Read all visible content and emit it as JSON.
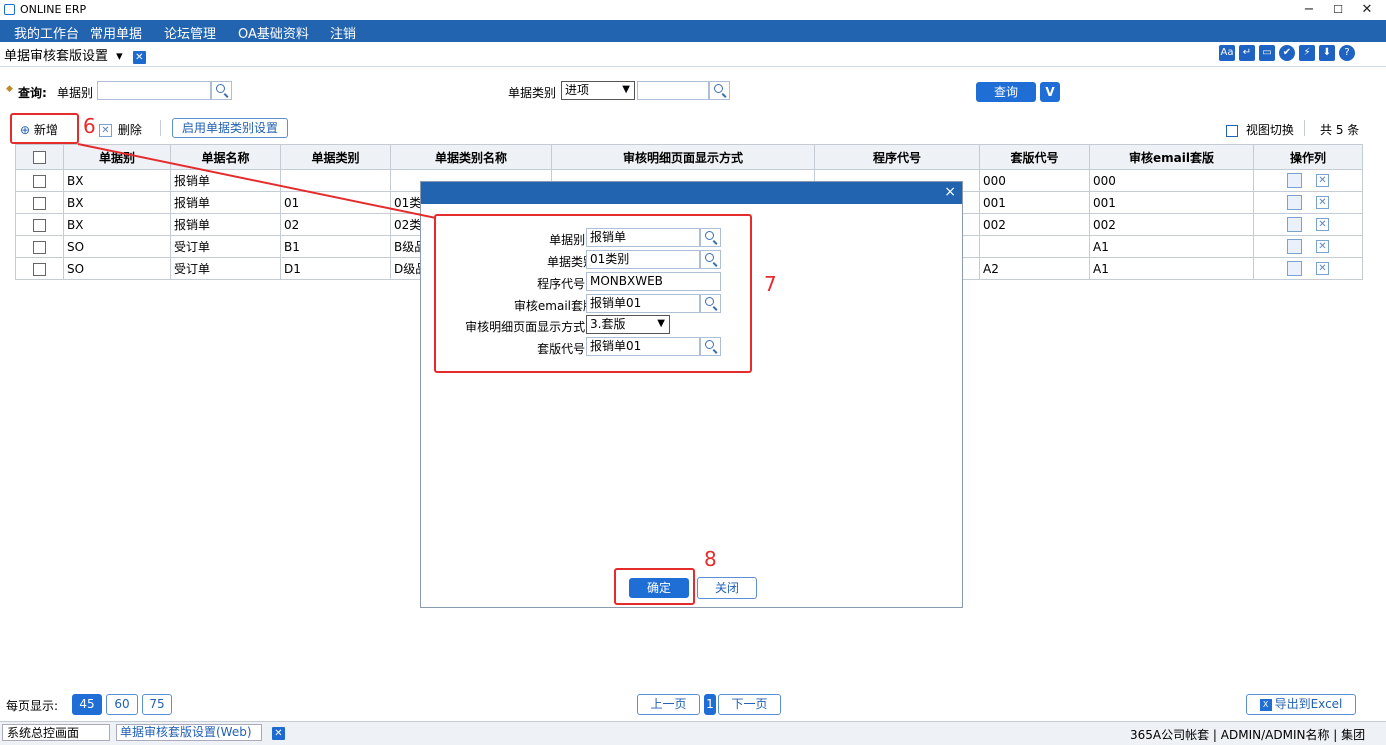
{
  "window": {
    "title": "ONLINE ERP",
    "minimize": "−",
    "maximize": "☐",
    "close": "✕"
  },
  "menu": [
    "我的工作台",
    "常用单据",
    "论坛管理",
    "OA基础资料",
    "注销"
  ],
  "tab": {
    "label": "单据审核套版设置",
    "dropdown": "▾",
    "close": "✕"
  },
  "toolbar_icons": [
    "Aa",
    "↵",
    "▭",
    "✔",
    "⚡",
    "⬇",
    "?"
  ],
  "query": {
    "label": "查询:",
    "field1_label": "单据别",
    "field1_value": "",
    "field2_label": "单据类别",
    "field2_value": "进项",
    "field3_value": "",
    "search_btn": "查询",
    "toggle_btn": "V"
  },
  "actions": {
    "add": "新增",
    "delete": "删除",
    "enable": "启用单据类别设置",
    "view_switch": "视图切换",
    "count": "共 5 条"
  },
  "table": {
    "headers": [
      "单据别",
      "单据名称",
      "单据类别",
      "单据类别名称",
      "审核明细页面显示方式",
      "程序代号",
      "套版代号",
      "审核email套版",
      "操作列"
    ],
    "rows": [
      [
        "BX",
        "报销单",
        "",
        "",
        "",
        "",
        "000",
        "000"
      ],
      [
        "BX",
        "报销单",
        "01",
        "01类别",
        "",
        "",
        "001",
        "001"
      ],
      [
        "BX",
        "报销单",
        "02",
        "02类别",
        "",
        "",
        "002",
        "002"
      ],
      [
        "SO",
        "受订单",
        "B1",
        "B级品",
        "",
        "",
        "",
        "A1"
      ],
      [
        "SO",
        "受订单",
        "D1",
        "D级品",
        "",
        "",
        "A2",
        "A1"
      ]
    ]
  },
  "dialog": {
    "close": "×",
    "fields": [
      {
        "label": "单据别",
        "required": "*",
        "value": "报销单"
      },
      {
        "label": "单据类别",
        "required": "",
        "value": "01类别"
      },
      {
        "label": "程序代号",
        "required": "*",
        "value": "MONBXWEB"
      },
      {
        "label": "审核email套版",
        "required": "",
        "value": "报销单01"
      },
      {
        "label": "审核明细页面显示方式",
        "required": "*",
        "value": "3.套版"
      },
      {
        "label": "套版代号",
        "required": "*",
        "value": "报销单01"
      }
    ],
    "ok": "确定",
    "cancel": "关闭"
  },
  "annotations": {
    "six": "6",
    "seven": "7",
    "eight": "8"
  },
  "pager": {
    "per_page_label": "每页显示:",
    "sizes": [
      "45",
      "60",
      "75"
    ],
    "prev": "上一页",
    "current": "1",
    "next": "下一页",
    "export": "导出到Excel"
  },
  "status": {
    "tab1": "系统总控画面",
    "tab2": "单据审核套版设置(Web)",
    "tab2_close": "✕",
    "right": "365A公司帐套 | ADMIN/ADMIN名称 | 集团"
  },
  "colors": {
    "accent": "#2264b0",
    "button": "#1e6ed6",
    "annotation": "#e42c2c"
  }
}
